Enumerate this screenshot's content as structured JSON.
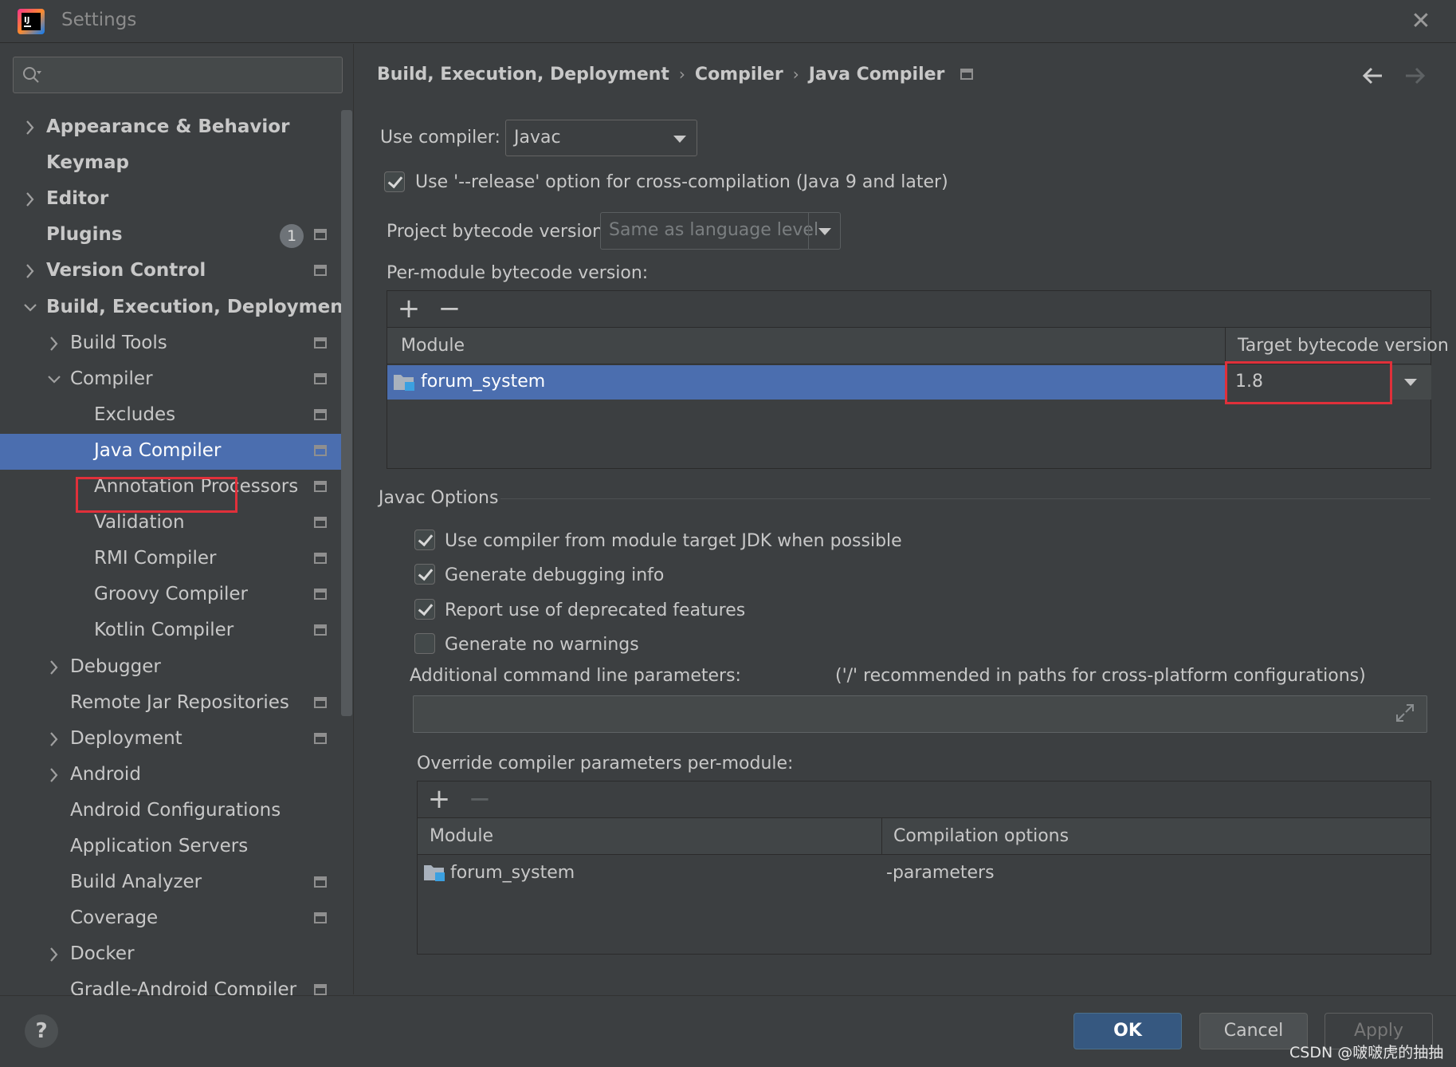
{
  "window": {
    "title": "Settings"
  },
  "sidebar": {
    "search_placeholder": "",
    "items": [
      {
        "label": "Appearance & Behavior",
        "expandable": true,
        "expanded": false,
        "level": 0,
        "bold": true,
        "has_module_icon": false
      },
      {
        "label": "Keymap",
        "expandable": false,
        "level": 0,
        "bold": true,
        "has_module_icon": false
      },
      {
        "label": "Editor",
        "expandable": true,
        "expanded": false,
        "level": 0,
        "bold": true,
        "has_module_icon": false
      },
      {
        "label": "Plugins",
        "expandable": false,
        "level": 0,
        "bold": true,
        "badge": "1",
        "has_module_icon": true
      },
      {
        "label": "Version Control",
        "expandable": true,
        "expanded": false,
        "level": 0,
        "bold": true,
        "has_module_icon": true
      },
      {
        "label": "Build, Execution, Deployment",
        "expandable": true,
        "expanded": true,
        "level": 0,
        "bold": true,
        "has_module_icon": false
      },
      {
        "label": "Build Tools",
        "expandable": true,
        "expanded": false,
        "level": 1,
        "has_module_icon": true
      },
      {
        "label": "Compiler",
        "expandable": true,
        "expanded": true,
        "level": 1,
        "has_module_icon": true
      },
      {
        "label": "Excludes",
        "expandable": false,
        "level": 2,
        "has_module_icon": true
      },
      {
        "label": "Java Compiler",
        "expandable": false,
        "level": 2,
        "selected": true,
        "has_module_icon": true
      },
      {
        "label": "Annotation Processors",
        "expandable": false,
        "level": 2,
        "has_module_icon": true
      },
      {
        "label": "Validation",
        "expandable": false,
        "level": 2,
        "has_module_icon": true
      },
      {
        "label": "RMI Compiler",
        "expandable": false,
        "level": 2,
        "has_module_icon": true
      },
      {
        "label": "Groovy Compiler",
        "expandable": false,
        "level": 2,
        "has_module_icon": true
      },
      {
        "label": "Kotlin Compiler",
        "expandable": false,
        "level": 2,
        "has_module_icon": true
      },
      {
        "label": "Debugger",
        "expandable": true,
        "expanded": false,
        "level": 1,
        "has_module_icon": false
      },
      {
        "label": "Remote Jar Repositories",
        "expandable": false,
        "level": 1,
        "has_module_icon": true
      },
      {
        "label": "Deployment",
        "expandable": true,
        "expanded": false,
        "level": 1,
        "has_module_icon": true
      },
      {
        "label": "Android",
        "expandable": true,
        "expanded": false,
        "level": 1,
        "has_module_icon": false
      },
      {
        "label": "Android Configurations",
        "expandable": false,
        "level": 1,
        "has_module_icon": false
      },
      {
        "label": "Application Servers",
        "expandable": false,
        "level": 1,
        "has_module_icon": false
      },
      {
        "label": "Build Analyzer",
        "expandable": false,
        "level": 1,
        "has_module_icon": true
      },
      {
        "label": "Coverage",
        "expandable": false,
        "level": 1,
        "has_module_icon": true
      },
      {
        "label": "Docker",
        "expandable": true,
        "expanded": false,
        "level": 1,
        "has_module_icon": false
      },
      {
        "label": "Gradle-Android Compiler",
        "expandable": false,
        "level": 1,
        "has_module_icon": true
      }
    ]
  },
  "breadcrumb": {
    "part1": "Build, Execution, Deployment",
    "part2": "Compiler",
    "part3": "Java Compiler",
    "separator": "›"
  },
  "main": {
    "use_compiler_label": "Use compiler:",
    "use_compiler_value": "Javac",
    "release_option_label": "Use '--release' option for cross-compilation (Java 9 and later)",
    "release_option_checked": true,
    "project_bytecode_label": "Project bytecode version:",
    "project_bytecode_value": "Same as language level",
    "per_module_label": "Per-module bytecode version:",
    "per_module_table": {
      "add": "+",
      "remove": "−",
      "columns": [
        "Module",
        "Target bytecode version"
      ],
      "rows": [
        {
          "module": "forum_system",
          "version": "1.8"
        }
      ]
    },
    "javac_options_title": "Javac Options",
    "options": [
      {
        "label": "Use compiler from module target JDK when possible",
        "checked": true
      },
      {
        "label": "Generate debugging info",
        "checked": true
      },
      {
        "label": "Report use of deprecated features",
        "checked": true
      },
      {
        "label": "Generate no warnings",
        "checked": false
      }
    ],
    "additional_params_label": "Additional command line parameters:",
    "additional_params_hint": "('/' recommended in paths for cross-platform configurations)",
    "additional_params_value": "",
    "override_label": "Override compiler parameters per-module:",
    "override_table": {
      "add": "+",
      "remove": "−",
      "columns": [
        "Module",
        "Compilation options"
      ],
      "rows": [
        {
          "module": "forum_system",
          "options": "-parameters"
        }
      ]
    }
  },
  "footer": {
    "help": "?",
    "ok": "OK",
    "cancel": "Cancel",
    "apply": "Apply"
  },
  "watermark": "CSDN @啵啵虎的抽抽",
  "colors": {
    "accent": "#4b6eaf",
    "highlight_box": "#e0303a",
    "ok_button": "#365880"
  },
  "icons": [
    "intellij-logo-icon",
    "close-icon",
    "search-icon",
    "chevron-right-icon",
    "chevron-down-icon",
    "module-settings-icon",
    "back-arrow-icon",
    "forward-arrow-icon",
    "folder-module-icon",
    "expand-icon",
    "help-icon",
    "checkbox-icon"
  ]
}
